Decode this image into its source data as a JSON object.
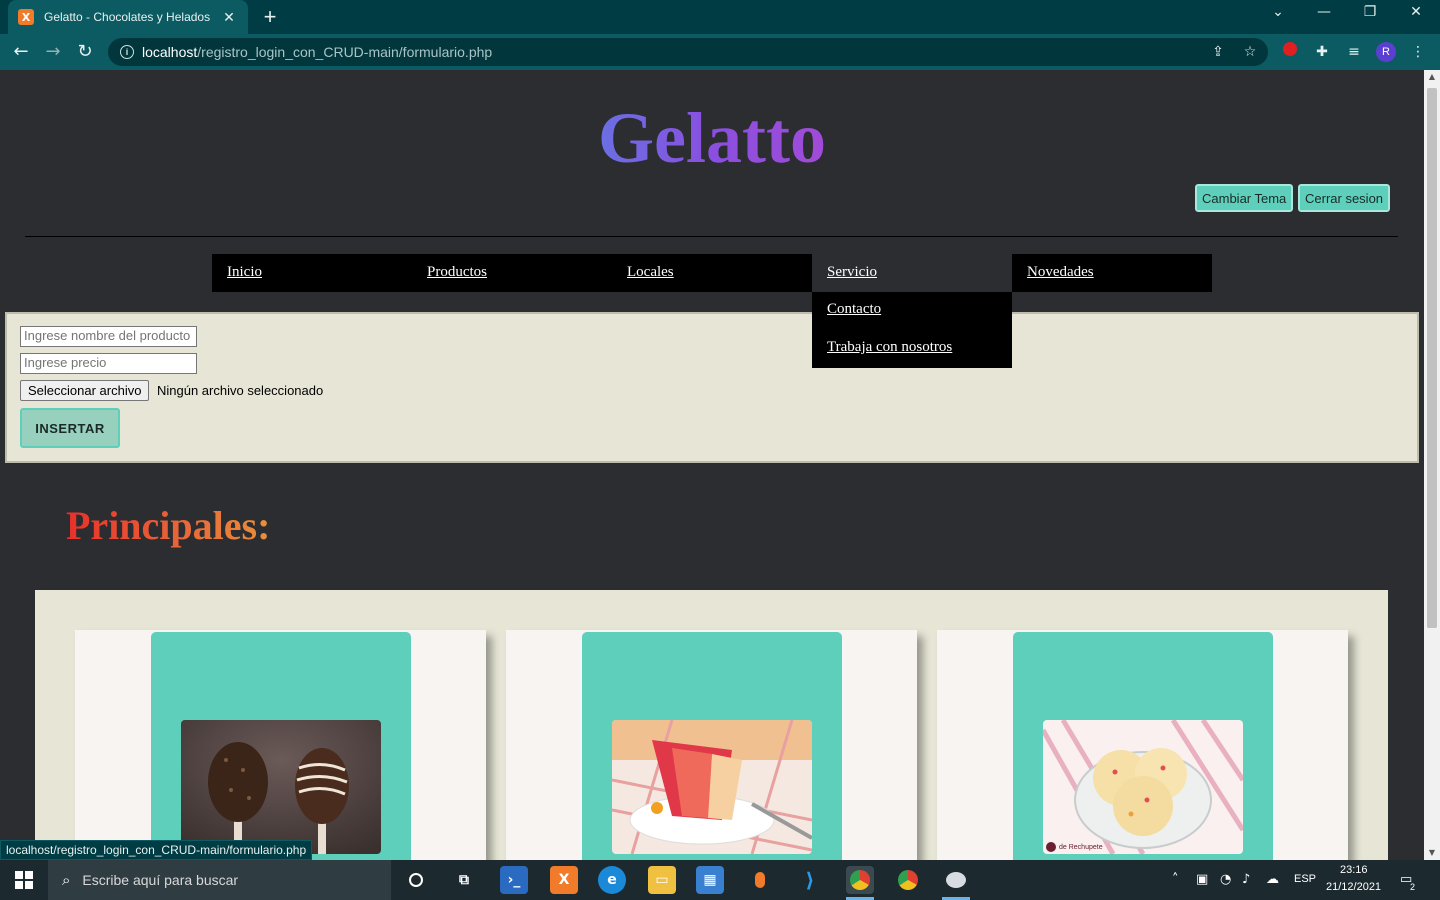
{
  "browser": {
    "tab_title": "Gelatto - Chocolates y Helados",
    "favicon_label": "X",
    "url_host": "localhost",
    "url_path": "/registro_login_con_CRUD-main/formulario.php",
    "profile_initial": "R",
    "status_url": "localhost/registro_login_con_CRUD-main/formulario.php"
  },
  "site": {
    "logo": "Gelatto",
    "buttons": {
      "theme": "Cambiar Tema",
      "logout": "Cerrar sesion"
    },
    "menu": [
      "Inicio",
      "Productos",
      "Locales",
      "Servicio",
      "Novedades"
    ],
    "dropdown": [
      "Contacto",
      "Trabaja con nosotros"
    ]
  },
  "form": {
    "name_placeholder": "Ingrese nombre del producto",
    "price_placeholder": "Ingrese precio",
    "file_button": "Seleccionar archivo",
    "file_status": "Ningún archivo seleccionado",
    "submit": "INSERTAR"
  },
  "section": {
    "title": "Principales:"
  },
  "products": [
    {
      "image": "chocolate-popsicles"
    },
    {
      "image": "layered-ice-cream-cake"
    },
    {
      "image": "ice-cream-scoops-bowl",
      "watermark": "de Rechupete"
    }
  ],
  "taskbar": {
    "search_placeholder": "Escribe aquí para buscar",
    "language": "ESP",
    "time": "23:16",
    "date": "21/12/2021",
    "notifications": "2"
  },
  "colors": {
    "accent": "#5dcfbb",
    "page_bg": "#2b2d30",
    "panel_bg": "#e7e6d6",
    "browser_frame": "#0c5b62"
  }
}
